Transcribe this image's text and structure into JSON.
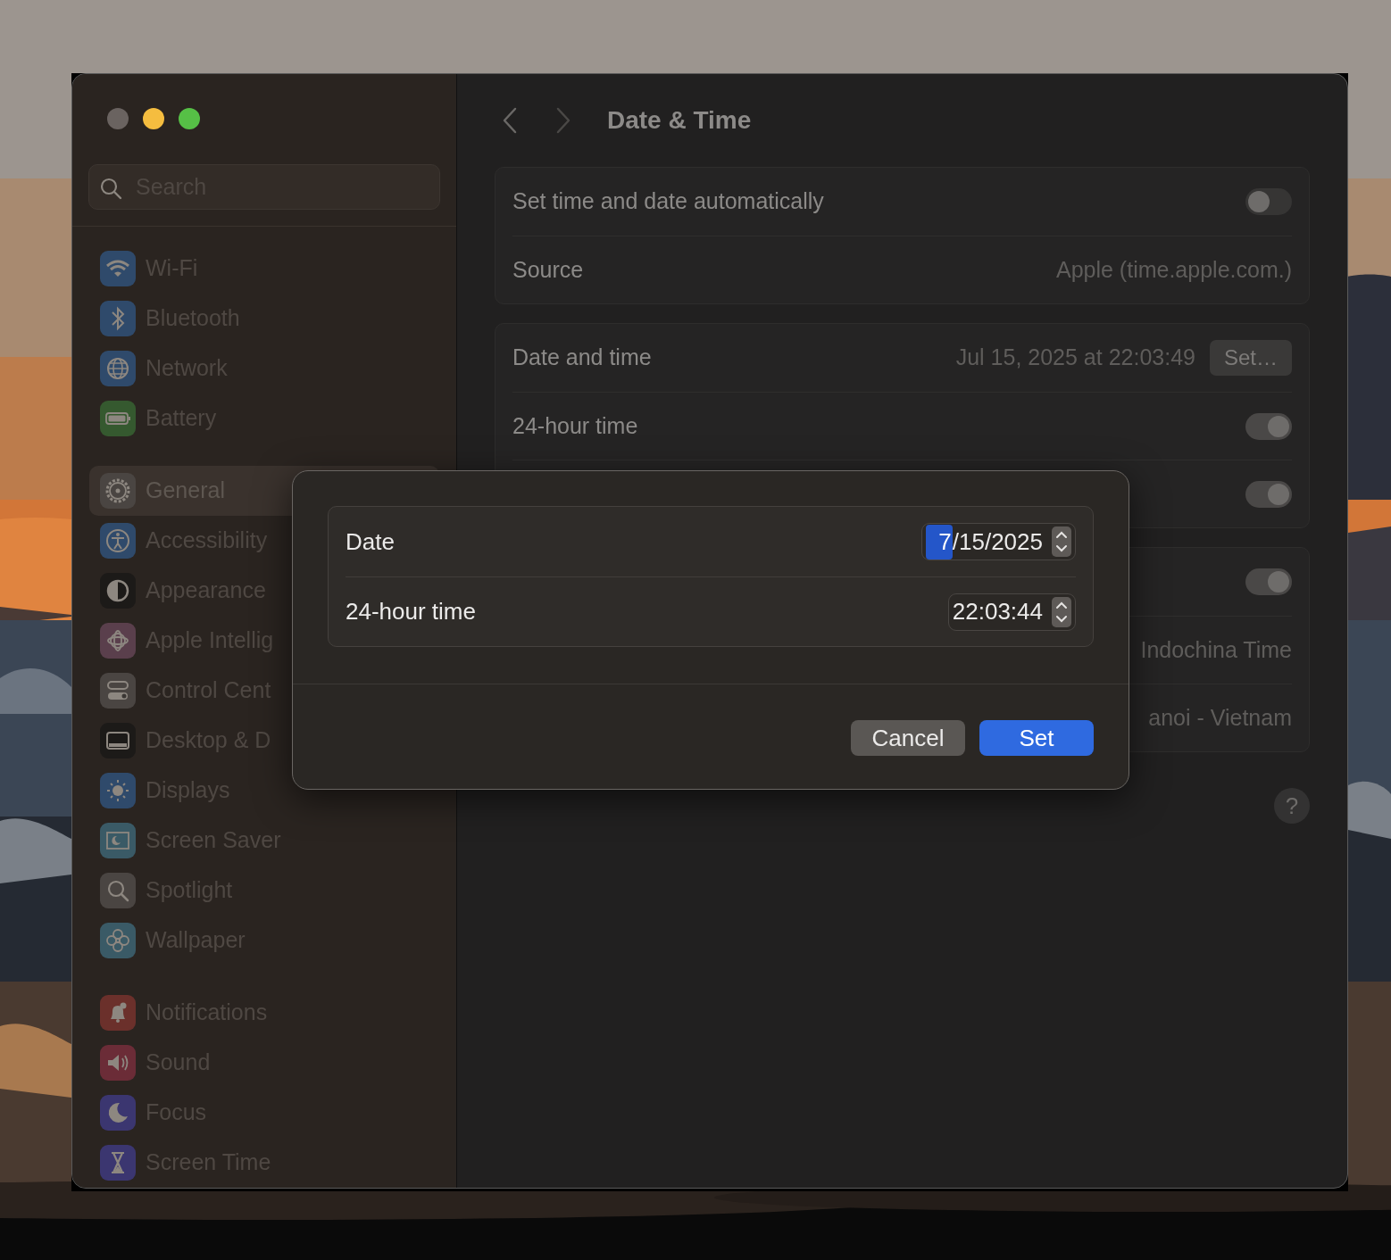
{
  "sidebar": {
    "search": {
      "placeholder": "Search"
    },
    "groups": [
      {
        "items": [
          {
            "label": "Wi-Fi",
            "color": "#2f4a6b",
            "selected": false
          },
          {
            "label": "Bluetooth",
            "color": "#2f4a6b",
            "selected": false
          },
          {
            "label": "Network",
            "color": "#2f4a6b",
            "selected": false
          },
          {
            "label": "Battery",
            "color": "#35592f",
            "selected": false
          }
        ]
      },
      {
        "items": [
          {
            "label": "General",
            "color": "#4a4542",
            "selected": true
          },
          {
            "label": "Accessibility",
            "color": "#2f4a6b",
            "selected": false
          },
          {
            "label": "Appearance",
            "color": "#1c1a18",
            "selected": false
          },
          {
            "label": "Apple Intellig",
            "color": "#5a3f4c",
            "selected": false
          },
          {
            "label": "Control Cent",
            "color": "#4a4542",
            "selected": false
          },
          {
            "label": "Desktop & D",
            "color": "#1c1a18",
            "selected": false
          },
          {
            "label": "Displays",
            "color": "#2f4a6b",
            "selected": false
          },
          {
            "label": "Screen Saver",
            "color": "#3a5a66",
            "selected": false
          },
          {
            "label": "Spotlight",
            "color": "#4a4542",
            "selected": false
          },
          {
            "label": "Wallpaper",
            "color": "#3a5a66",
            "selected": false
          }
        ]
      },
      {
        "items": [
          {
            "label": "Notifications",
            "color": "#6b302b",
            "selected": false
          },
          {
            "label": "Sound",
            "color": "#6b2c37",
            "selected": false
          },
          {
            "label": "Focus",
            "color": "#3b3670",
            "selected": false
          },
          {
            "label": "Screen Time",
            "color": "#3b3670",
            "selected": false
          }
        ]
      }
    ]
  },
  "header": {
    "title": "Date & Time"
  },
  "cards": [
    {
      "rows": [
        {
          "kind": "toggle",
          "label": "Set time and date automatically",
          "on": false
        },
        {
          "kind": "value",
          "label": "Source",
          "value": "Apple (time.apple.com.)"
        }
      ]
    },
    {
      "rows": [
        {
          "kind": "value_button",
          "label": "Date and time",
          "value": "Jul 15, 2025 at 22:03:49",
          "button": "Set…"
        },
        {
          "kind": "toggle",
          "label": "24-hour time",
          "on": true
        },
        {
          "kind": "toggle",
          "on": true
        }
      ]
    },
    {
      "rows": [
        {
          "kind": "toggle",
          "on": true
        },
        {
          "kind": "value",
          "value": "Indochina Time"
        },
        {
          "kind": "value",
          "value": "anoi - Vietnam"
        }
      ]
    }
  ],
  "help_button": "?",
  "dialog": {
    "rows": [
      {
        "label": "Date",
        "segments": [
          {
            "text": "7",
            "selected": true
          },
          {
            "text": "/",
            "selected": false
          },
          {
            "text": "15",
            "selected": false
          },
          {
            "text": "/",
            "selected": false
          },
          {
            "text": "2025",
            "selected": false
          }
        ]
      },
      {
        "label": "24-hour time",
        "segments": [
          {
            "text": "22",
            "selected": false
          },
          {
            "text": ":",
            "selected": false
          },
          {
            "text": "03",
            "selected": false
          },
          {
            "text": ":",
            "selected": false
          },
          {
            "text": "44",
            "selected": false
          }
        ]
      }
    ],
    "buttons": [
      {
        "label": "Cancel",
        "kind": "secondary"
      },
      {
        "label": "Set",
        "kind": "primary"
      }
    ]
  }
}
